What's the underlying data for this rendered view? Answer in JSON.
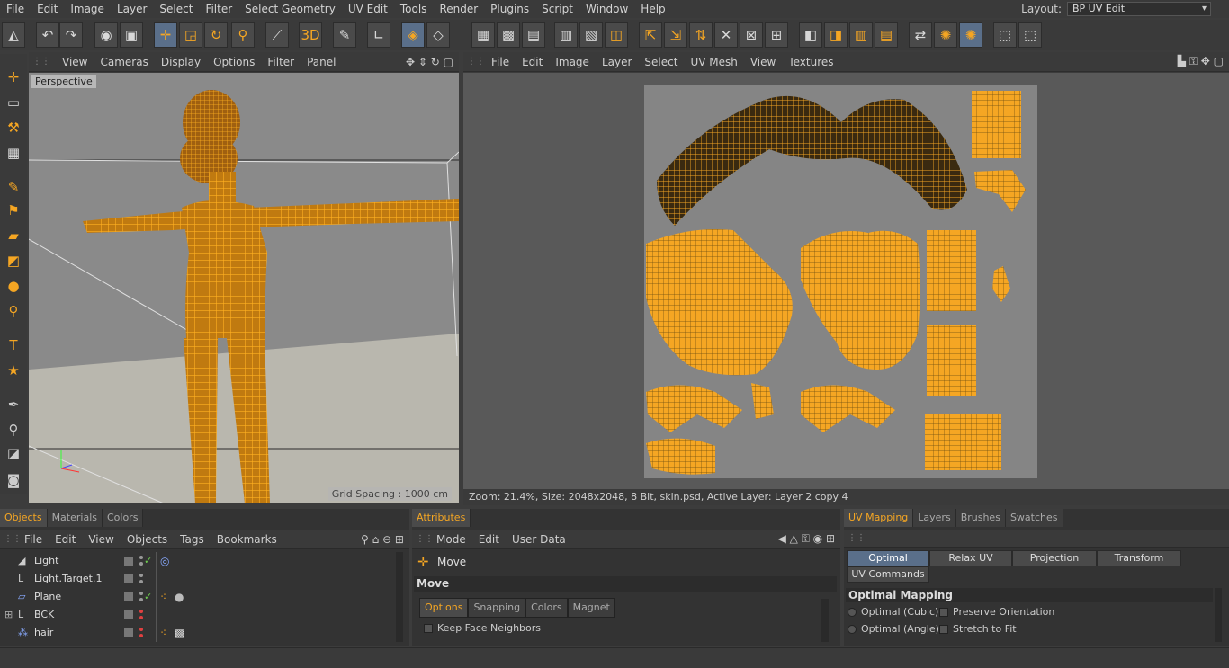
{
  "menubar": {
    "items": [
      "File",
      "Edit",
      "Image",
      "Layer",
      "Select",
      "Filter",
      "Select Geometry",
      "UV Edit",
      "Tools",
      "Render",
      "Plugins",
      "Script",
      "Window",
      "Help"
    ],
    "layout_label": "Layout:",
    "layout_value": "BP UV Edit"
  },
  "viewport": {
    "menu": [
      "View",
      "Cameras",
      "Display",
      "Options",
      "Filter",
      "Panel"
    ],
    "label": "Perspective",
    "grid_spacing": "Grid Spacing : 1000 cm"
  },
  "uv_editor": {
    "menu": [
      "File",
      "Edit",
      "Image",
      "Layer",
      "Select",
      "UV Mesh",
      "View",
      "Textures"
    ],
    "status": "Zoom: 21.4%, Size: 2048x2048, 8 Bit, skin.psd, Active Layer: Layer 2 copy 4"
  },
  "objects_panel": {
    "tabs": [
      "Objects",
      "Materials",
      "Colors"
    ],
    "menu": [
      "File",
      "Edit",
      "View",
      "Objects",
      "Tags",
      "Bookmarks"
    ],
    "rows": [
      {
        "name": "Light"
      },
      {
        "name": "Light.Target.1"
      },
      {
        "name": "Plane"
      },
      {
        "name": "BCK"
      },
      {
        "name": "hair"
      }
    ]
  },
  "attributes_panel": {
    "tabs": [
      "Attributes"
    ],
    "menu": [
      "Mode",
      "Edit",
      "User Data"
    ],
    "tool": "Move",
    "section": "Move",
    "subtabs": [
      "Options",
      "Snapping",
      "Colors",
      "Magnet"
    ],
    "option": "Keep Face Neighbors"
  },
  "uv_panel": {
    "tabs": [
      "UV Mapping",
      "Layers",
      "Brushes",
      "Swatches"
    ],
    "buttons": [
      "Optimal Mapping",
      "Relax UV",
      "Projection",
      "Transform",
      "UV Commands"
    ],
    "section": "Optimal Mapping",
    "radios": [
      "Optimal (Cubic)",
      "Optimal (Angle)"
    ],
    "checks": [
      "Preserve Orientation",
      "Stretch to Fit"
    ]
  },
  "colors": {
    "accent": "#f5a623",
    "wire": "#f5a623",
    "panel_bg": "#333333"
  }
}
